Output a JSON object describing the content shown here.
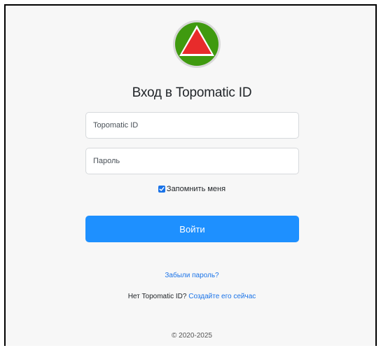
{
  "logo": {
    "icon": "green-circle-red-triangle-icon",
    "colors": {
      "circle": "#3f9a0f",
      "ring": "#d8d8d8",
      "triangle": "#e82b2b",
      "triangle_border": "#ffffff"
    }
  },
  "login": {
    "title": "Вход в Topomatic ID",
    "id_placeholder": "Topomatic ID",
    "password_placeholder": "Пароль",
    "remember_label": "Запомнить меня",
    "remember_checked": true,
    "submit_label": "Войти",
    "forgot_label": "Забыли пароль?",
    "no_account_text": "Нет Topomatic ID?",
    "create_link_label": "Создайте его сейчас",
    "copyright": "© 2020-2025"
  },
  "colors": {
    "accent": "#1e90ff",
    "link": "#1a73e8",
    "background": "#f7f7f7"
  }
}
